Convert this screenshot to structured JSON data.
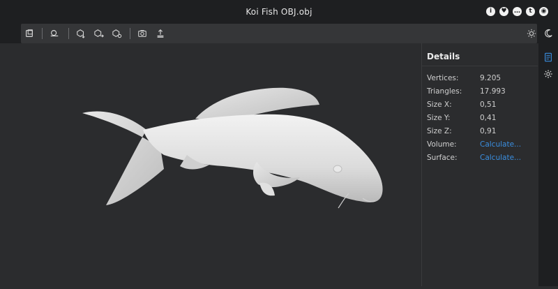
{
  "window": {
    "title": "Koi Fish OBJ.obj"
  },
  "top_icons": [
    "info-icon",
    "heart-icon",
    "chat-icon",
    "twitter-icon",
    "github-icon"
  ],
  "toolbar": {
    "tools": [
      "cube-icon",
      "copy-icon",
      "orbit-icon",
      "export-down-icon",
      "export-right-icon",
      "export-settings-icon",
      "camera-icon",
      "upload-icon",
      "sun-icon",
      "moon-icon"
    ]
  },
  "details": {
    "title": "Details",
    "rows": [
      {
        "key": "Vertices:",
        "value": "9.205"
      },
      {
        "key": "Triangles:",
        "value": "17.993"
      },
      {
        "key": "Size X:",
        "value": "0,51"
      },
      {
        "key": "Size Y:",
        "value": "0,41"
      },
      {
        "key": "Size Z:",
        "value": "0,91"
      },
      {
        "key": "Volume:",
        "value": "Calculate..."
      },
      {
        "key": "Surface:",
        "value": "Calculate..."
      }
    ]
  },
  "sidebar": [
    "details-icon",
    "settings-icon"
  ],
  "colors": {
    "link": "#3a8ee0",
    "panel": "#2b2c2e",
    "bar": "#1e1f21"
  }
}
